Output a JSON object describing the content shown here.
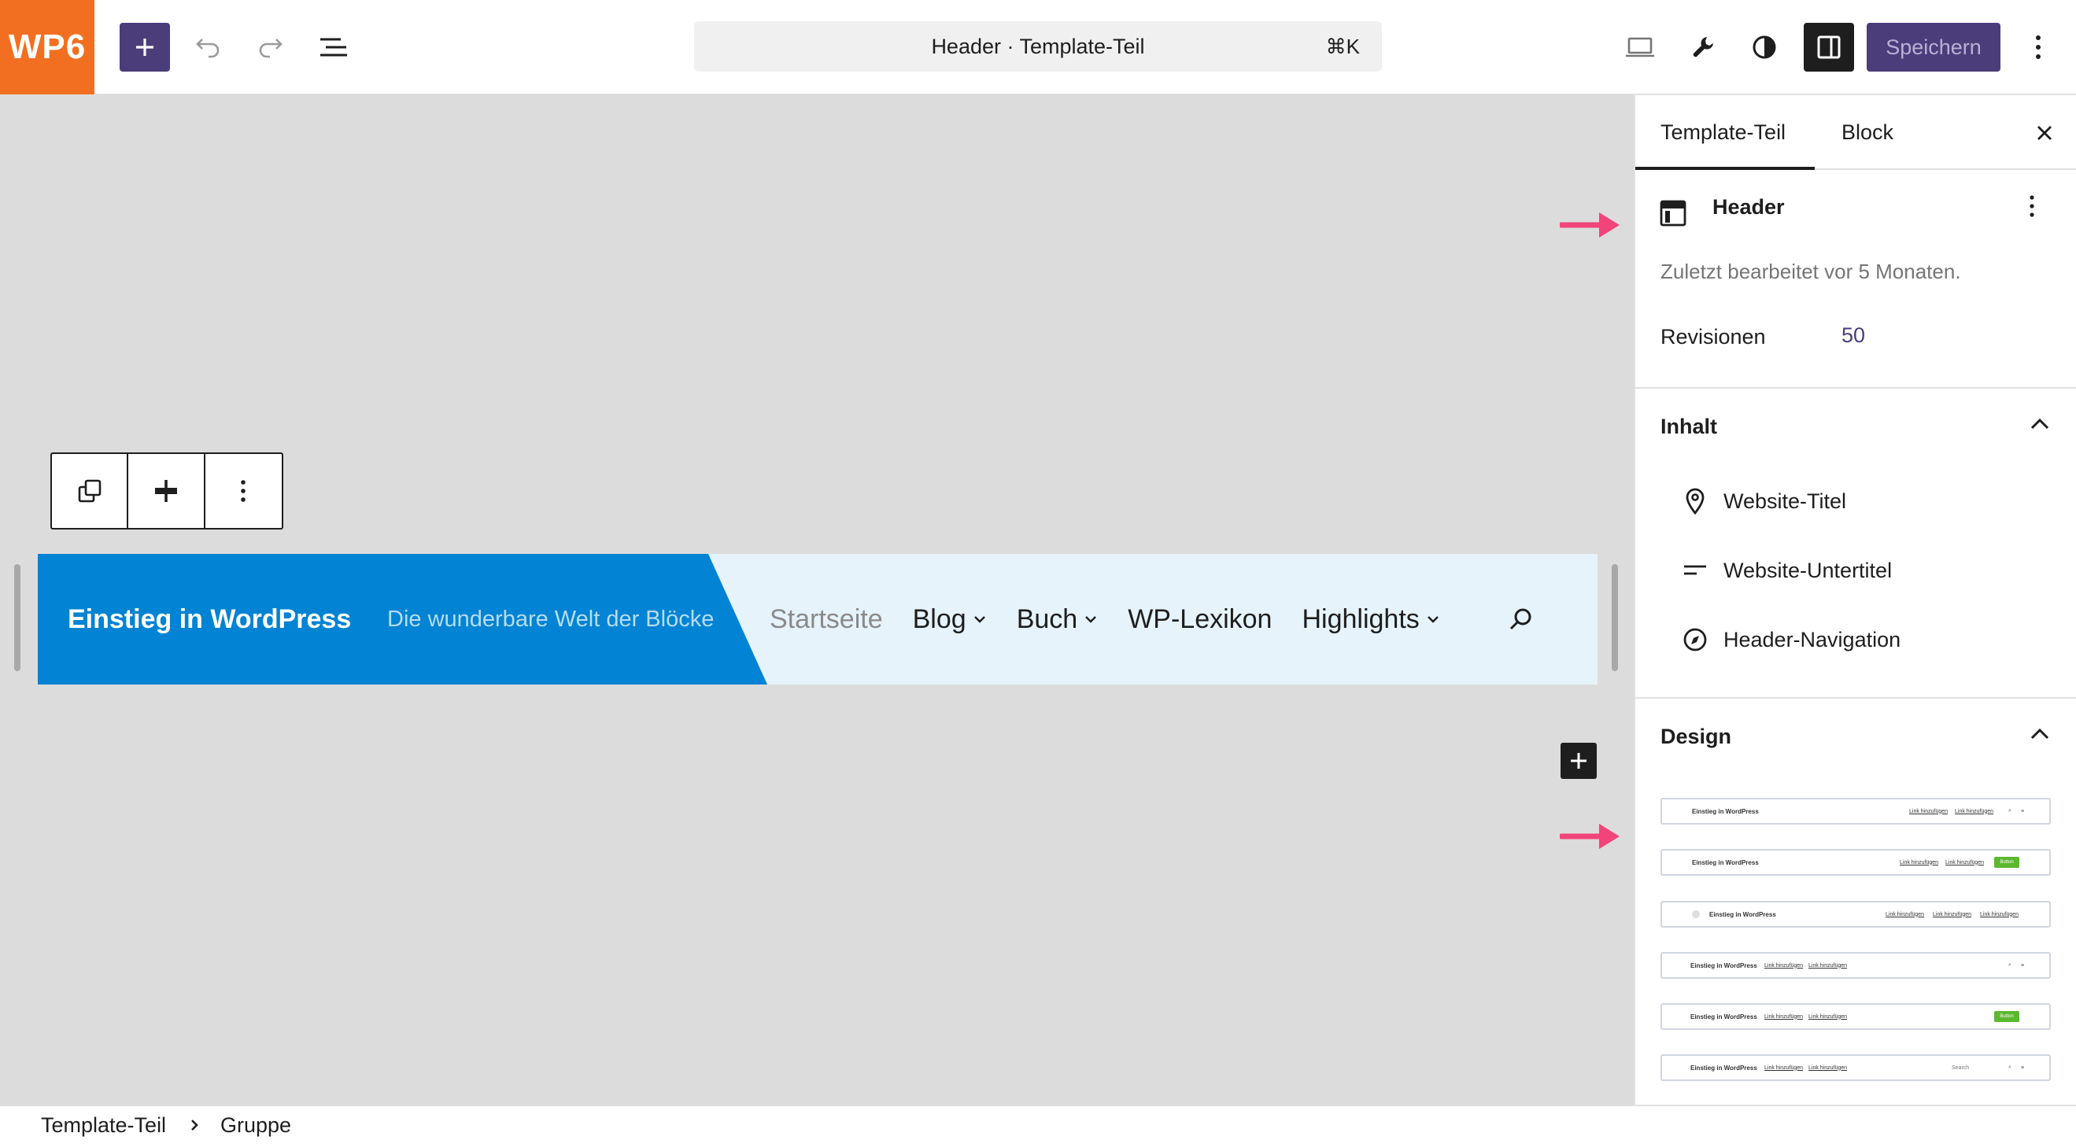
{
  "topbar": {
    "logo": "WP6",
    "command_label": "Header · Template-Teil",
    "command_shortcut": "⌘K",
    "save_label": "Speichern"
  },
  "canvas": {
    "site_title": "Einstieg in WordPress",
    "tagline": "Die wunderbare Welt der Blöcke",
    "nav": [
      {
        "label": "Startseite",
        "has_submenu": false
      },
      {
        "label": "Blog",
        "has_submenu": true
      },
      {
        "label": "Buch",
        "has_submenu": true
      },
      {
        "label": "WP-Lexikon",
        "has_submenu": false
      },
      {
        "label": "Highlights",
        "has_submenu": true
      }
    ],
    "colors": {
      "header_blue": "#0283d3",
      "header_light": "#e6f3fb",
      "annotation_arrow": "#f0447a"
    }
  },
  "sidebar": {
    "tabs": [
      {
        "label": "Template-Teil",
        "active": true
      },
      {
        "label": "Block",
        "active": false
      }
    ],
    "card": {
      "title": "Header",
      "description": "Zuletzt bearbeitet vor 5 Monaten.",
      "revisions_label": "Revisionen",
      "revisions_value": "50"
    },
    "content_panel": {
      "title": "Inhalt",
      "items": [
        {
          "label": "Website-Titel",
          "icon": "map-marker-icon"
        },
        {
          "label": "Website-Untertitel",
          "icon": "subtitle-icon"
        },
        {
          "label": "Header-Navigation",
          "icon": "compass-icon"
        }
      ]
    },
    "design_panel": {
      "title": "Design",
      "pattern_site_title": "Einstieg in WordPress",
      "pattern_link": "Link hinzufügen",
      "pattern_button": "Button",
      "pattern_search": "Search"
    }
  },
  "footer": {
    "breadcrumb": [
      "Template-Teil",
      "Gruppe"
    ]
  }
}
